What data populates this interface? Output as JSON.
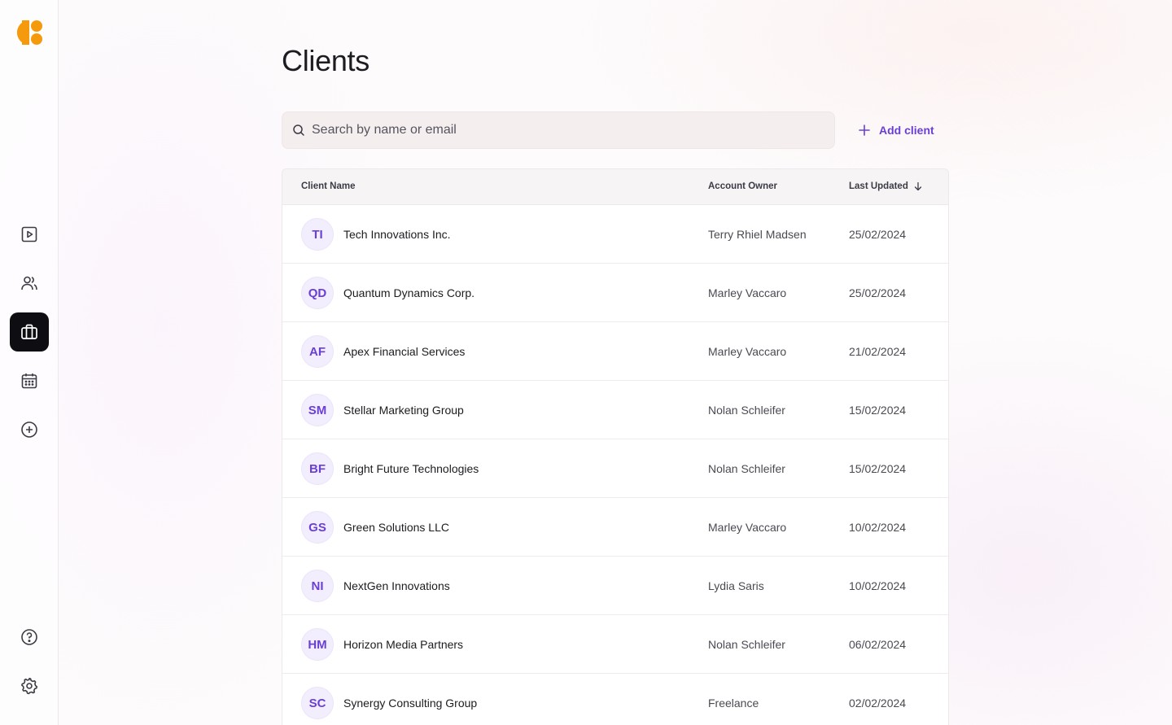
{
  "page": {
    "title": "Clients"
  },
  "search": {
    "placeholder": "Search by name or email",
    "value": ""
  },
  "actions": {
    "add_client_label": "Add client"
  },
  "sidebar": {
    "items": [
      {
        "name": "media-play",
        "icon": "play-square-icon",
        "active": false
      },
      {
        "name": "contacts",
        "icon": "users-icon",
        "active": false
      },
      {
        "name": "clients",
        "icon": "briefcase-icon",
        "active": true
      },
      {
        "name": "calendar",
        "icon": "calendar-icon",
        "active": false
      },
      {
        "name": "add",
        "icon": "plus-circle-icon",
        "active": false
      }
    ],
    "bottom_items": [
      {
        "name": "help",
        "icon": "help-circle-icon"
      },
      {
        "name": "settings",
        "icon": "gear-icon"
      }
    ]
  },
  "table": {
    "columns": {
      "client_name": "Client Name",
      "account_owner": "Account Owner",
      "last_updated": "Last Updated"
    },
    "sort": {
      "column": "last_updated",
      "direction": "desc"
    },
    "rows": [
      {
        "initials": "TI",
        "name": "Tech Innovations Inc.",
        "owner": "Terry Rhiel Madsen",
        "updated": "25/02/2024"
      },
      {
        "initials": "QD",
        "name": "Quantum Dynamics Corp.",
        "owner": "Marley Vaccaro",
        "updated": "25/02/2024"
      },
      {
        "initials": "AF",
        "name": "Apex Financial Services",
        "owner": "Marley Vaccaro",
        "updated": "21/02/2024"
      },
      {
        "initials": "SM",
        "name": "Stellar Marketing Group",
        "owner": "Nolan Schleifer",
        "updated": "15/02/2024"
      },
      {
        "initials": "BF",
        "name": "Bright Future Technologies",
        "owner": "Nolan Schleifer",
        "updated": "15/02/2024"
      },
      {
        "initials": "GS",
        "name": "Green Solutions LLC",
        "owner": "Marley Vaccaro",
        "updated": "10/02/2024"
      },
      {
        "initials": "NI",
        "name": "NextGen Innovations",
        "owner": "Lydia Saris",
        "updated": "10/02/2024"
      },
      {
        "initials": "HM",
        "name": "Horizon Media Partners",
        "owner": "Nolan Schleifer",
        "updated": "06/02/2024"
      },
      {
        "initials": "SC",
        "name": "Synergy Consulting Group",
        "owner": "Freelance",
        "updated": "02/02/2024"
      }
    ]
  },
  "colors": {
    "accent": "#6a3fd6",
    "logo": "#f59a0c",
    "active_nav_bg": "#0e0e12"
  }
}
